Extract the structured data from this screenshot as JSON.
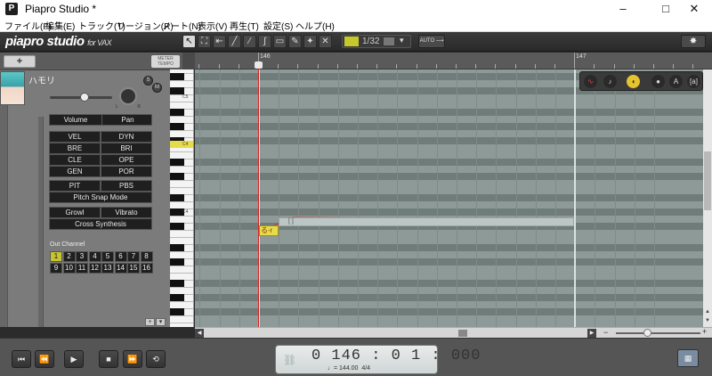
{
  "window": {
    "title": "Piapro Studio *",
    "app_icon": "P",
    "minimize": "–",
    "maximize": "□",
    "close": "✕"
  },
  "menu": [
    "ファイル(F)",
    "編集(E)",
    "トラック(T)",
    "リージョン(R)",
    "ノート(N)",
    "表示(V)",
    "再生(T)",
    "設定(S)",
    "ヘルプ(H)"
  ],
  "logo": {
    "main": "piapro studio",
    "sub": "for VAX"
  },
  "toolbar": {
    "quantize": "1/32",
    "auto": "AUTO ⟶"
  },
  "track": {
    "add": "+",
    "meter_tempo": "METER TEMPO",
    "name": "ハモリ",
    "solo": "S",
    "mute": "M",
    "volume_level": 0.55,
    "pan_left": "L",
    "pan_right": "R"
  },
  "panel_buttons": {
    "volume": "Volume",
    "pan": "Pan",
    "vel": "VEL",
    "dyn": "DYN",
    "bre": "BRE",
    "bri": "BRI",
    "cle": "CLE",
    "ope": "OPE",
    "gen": "GEN",
    "por": "POR",
    "pit": "PIT",
    "pbs": "PBS",
    "pitch_snap": "Pitch Snap Mode",
    "growl": "Growl",
    "vibrato": "Vibrato",
    "cross": "Cross Synthesis"
  },
  "out_channel": {
    "label": "Out Channel",
    "selected": "1",
    "channels": [
      "1",
      "2",
      "3",
      "4",
      "5",
      "6",
      "7",
      "8",
      "9",
      "10",
      "11",
      "12",
      "13",
      "14",
      "15",
      "16"
    ]
  },
  "keyboard": {
    "c5": "C5",
    "c4_highlight": "C4",
    "c4": "C4"
  },
  "ruler": {
    "marks": [
      "146",
      "147"
    ]
  },
  "note": {
    "lyric": "る-r",
    "ghost": "[ ]"
  },
  "transport": {
    "position": "0 146 : 0 1 : 000",
    "tempo": "♩= 144.00",
    "signature": "4/4"
  },
  "colors": {
    "note": "#e6dc4a",
    "playhead": "#e02020",
    "selected_channel": "#c5c32e"
  }
}
